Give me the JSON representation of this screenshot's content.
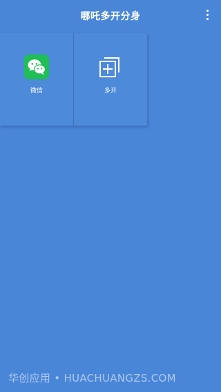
{
  "header": {
    "title": "哪吒多开分身",
    "more_icon": "more-vertical-icon"
  },
  "apps": [
    {
      "label": "微信",
      "icon": "wechat-icon",
      "icon_color": "#1fbf55"
    },
    {
      "label": "多开",
      "icon": "add-clone-icon"
    }
  ],
  "watermark": "华创应用 • HUACHUANGZS.COM",
  "colors": {
    "background": "#4a86d8",
    "card": "#4d8ad9",
    "text": "#ffffff"
  }
}
